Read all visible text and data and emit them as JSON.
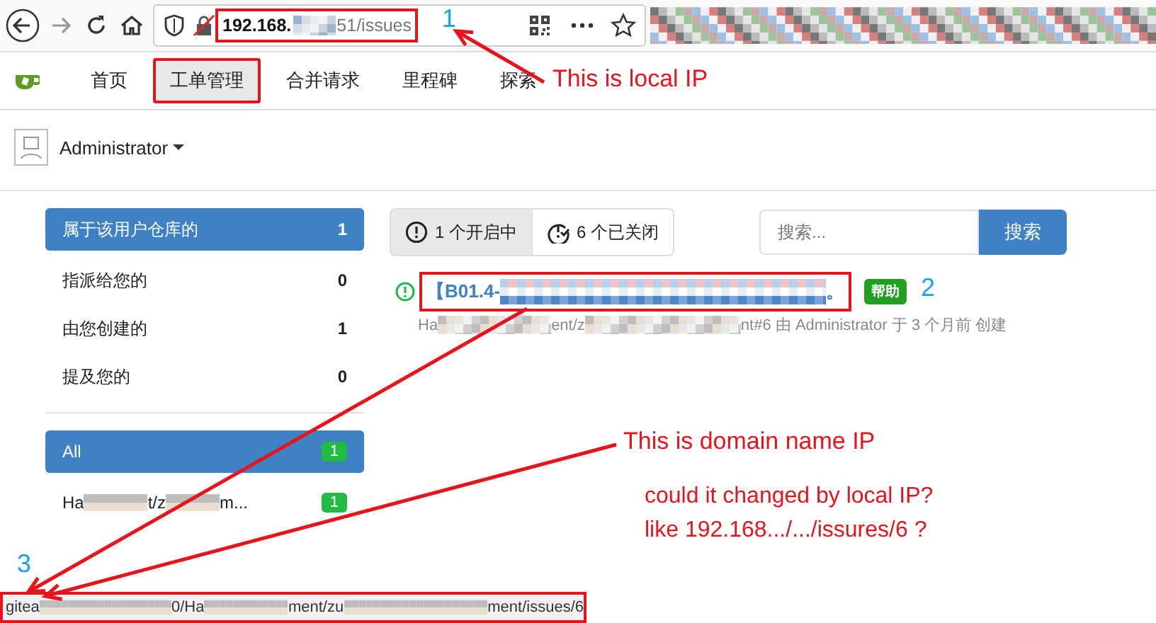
{
  "browser": {
    "url": [
      {
        "kind": "strong",
        "text": "192.168."
      },
      {
        "kind": "blur"
      },
      {
        "kind": "text",
        "text": "51/issues"
      }
    ],
    "annotated": true
  },
  "nav": {
    "items": [
      {
        "label": "首页",
        "selected": false,
        "annotated": false
      },
      {
        "label": "工单管理",
        "selected": true,
        "annotated": true
      },
      {
        "label": "合并请求",
        "selected": false,
        "annotated": false
      },
      {
        "label": "里程碑",
        "selected": false,
        "annotated": false
      },
      {
        "label": "探索",
        "selected": false,
        "annotated": false
      }
    ]
  },
  "user": {
    "name": "Administrator"
  },
  "filters": [
    {
      "label": "属于该用户仓库的",
      "count": "1",
      "selected": true
    },
    {
      "label": "指派给您的",
      "count": "0",
      "selected": false
    },
    {
      "label": "由您创建的",
      "count": "1",
      "selected": false
    },
    {
      "label": "提及您的",
      "count": "0",
      "selected": false
    }
  ],
  "repos": [
    {
      "label": [
        {
          "kind": "text",
          "text": "All"
        }
      ],
      "count": "1",
      "selected": true
    },
    {
      "label": [
        {
          "kind": "text",
          "text": "Ha"
        },
        {
          "kind": "blur"
        },
        {
          "kind": "text",
          "text": "t/z"
        },
        {
          "kind": "blur"
        },
        {
          "kind": "text",
          "text": "m..."
        }
      ],
      "count": "1",
      "selected": false
    }
  ],
  "tabs": [
    {
      "kind": "open",
      "label": "1 个开启中",
      "selected": true
    },
    {
      "kind": "closed",
      "label": "6 个已关闭",
      "selected": false
    }
  ],
  "search": {
    "placeholder": "搜索...",
    "button": "搜索"
  },
  "issues": [
    {
      "title": [
        {
          "kind": "text",
          "text": "【B01.4-"
        },
        {
          "kind": "blur"
        },
        {
          "kind": "text",
          "text": "。"
        }
      ],
      "annotated": true,
      "label": "帮助",
      "meta": [
        {
          "kind": "text",
          "text": "Ha"
        },
        {
          "kind": "blur"
        },
        {
          "kind": "text",
          "text": "ent/z"
        },
        {
          "kind": "blur"
        },
        {
          "kind": "text",
          "text": "nt#6 由 Administrator 于 3 个月前 创建"
        }
      ]
    }
  ],
  "status_bar": {
    "url": [
      {
        "kind": "text",
        "text": "gitea"
      },
      {
        "kind": "blur"
      },
      {
        "kind": "text",
        "text": "0/Ha"
      },
      {
        "kind": "blur"
      },
      {
        "kind": "text",
        "text": "ment/zu"
      },
      {
        "kind": "blur"
      },
      {
        "kind": "text",
        "text": "ment/issues/6"
      }
    ],
    "annotated": true
  },
  "annotations": [
    {
      "kind": "number",
      "text": "1"
    },
    {
      "kind": "note",
      "text": "This is local IP"
    },
    {
      "kind": "number",
      "text": "2"
    },
    {
      "kind": "note",
      "text": "This is domain name IP"
    },
    {
      "kind": "note",
      "text": "could it changed by local IP?"
    },
    {
      "kind": "note",
      "text": "like 192.168.../.../issures/6 ?"
    },
    {
      "kind": "number",
      "text": "3"
    }
  ]
}
